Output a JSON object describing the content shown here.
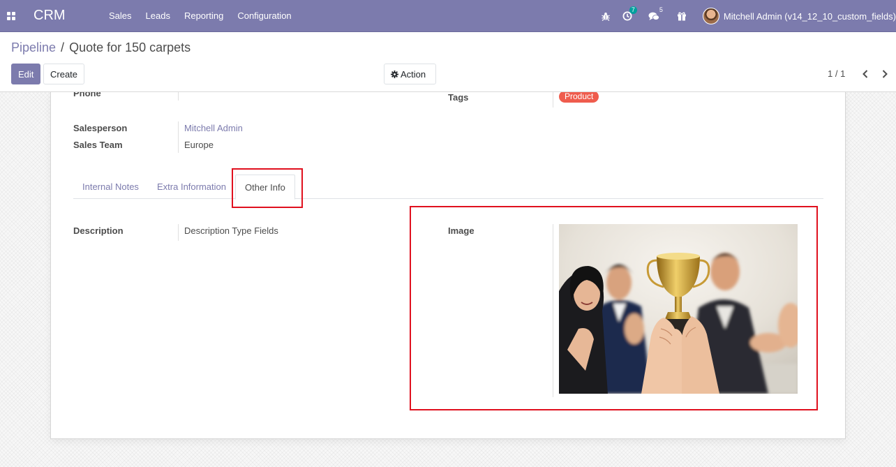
{
  "navbar": {
    "app_name": "CRM",
    "menu": [
      "Sales",
      "Leads",
      "Reporting",
      "Configuration"
    ],
    "activity_count": "7",
    "message_count": "5",
    "user_name": "Mitchell Admin (v14_12_10_custom_fields)",
    "icons": [
      "apps-icon",
      "bug-icon",
      "clock-icon",
      "chat-icon",
      "gift-icon"
    ],
    "color": "#7c7bad"
  },
  "breadcrumb": {
    "parent": "Pipeline",
    "separator": "/",
    "current": "Quote for 150 carpets"
  },
  "buttons": {
    "edit": "Edit",
    "create": "Create",
    "action": "Action"
  },
  "pager": {
    "value": "1 / 1"
  },
  "form": {
    "phone_label": "Phone",
    "tags_label": "Tags",
    "tag_value": "Product",
    "tag_color": "#ef5c4d",
    "salesperson_label": "Salesperson",
    "salesperson_value": "Mitchell Admin",
    "sales_team_label": "Sales Team",
    "sales_team_value": "Europe"
  },
  "tabs": {
    "items": [
      "Internal Notes",
      "Extra Information",
      "Other Info"
    ],
    "active": "Other Info"
  },
  "other_info": {
    "description_label": "Description",
    "description_value": "Description Type Fields",
    "image_label": "Image"
  },
  "highlight_color": "#e0101e"
}
